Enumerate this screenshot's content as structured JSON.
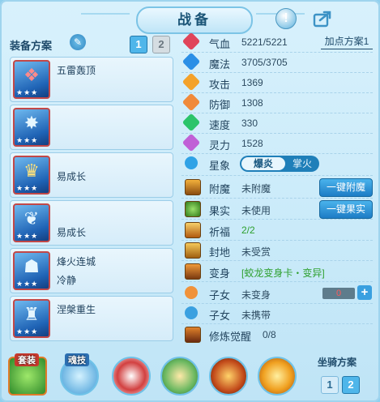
{
  "title": "战备",
  "header": {
    "help_icon": "exclamation-icon",
    "share_icon": "share-icon"
  },
  "equip_plan": {
    "label": "装备方案",
    "tabs": [
      "1",
      "2"
    ],
    "active_tab": "1"
  },
  "equip_cards": [
    {
      "name": "五雷轰顶",
      "sub": "",
      "stars": "★★★",
      "icon": "popsicle-icon"
    },
    {
      "name": "",
      "sub": "",
      "stars": "★★★",
      "icon": "crab-icon"
    },
    {
      "name": "易成长",
      "sub": "",
      "stars": "★★★",
      "icon": "beast-icon"
    },
    {
      "name": "易成长",
      "sub": "",
      "stars": "★★★",
      "icon": "dragon-icon"
    },
    {
      "name": "烽火连城",
      "sub": "冷静",
      "stars": "★★★",
      "icon": "mask-icon"
    },
    {
      "name": "涅槃重生",
      "sub": "",
      "stars": "★★★",
      "icon": "statue-icon"
    }
  ],
  "stats": [
    {
      "label": "气血",
      "value": "5221/5221",
      "color": "#e0445a"
    },
    {
      "label": "魔法",
      "value": "3705/3705",
      "color": "#2b8fe6"
    },
    {
      "label": "攻击",
      "value": "1369",
      "color": "#f4a22a"
    },
    {
      "label": "防御",
      "value": "1308",
      "color": "#f08a3a"
    },
    {
      "label": "速度",
      "value": "330",
      "color": "#2bc46a"
    },
    {
      "label": "灵力",
      "value": "1528",
      "color": "#c060d6"
    }
  ],
  "add_point_plan": "加点方案1",
  "constellation": {
    "label": "星象",
    "option_a": "爆炎",
    "option_b": "掌火"
  },
  "extras": [
    {
      "label": "附魔",
      "value": "未附魔",
      "value_color": "#2c4a60"
    },
    {
      "label": "果实",
      "value": "未使用",
      "value_color": "#2c4a60"
    },
    {
      "label": "祈福",
      "value": "2/2",
      "value_color": "#2ea02e"
    },
    {
      "label": "封地",
      "value": "未受赏",
      "value_color": "#2c4a60"
    },
    {
      "label": "变身",
      "value": "[蛟龙变身卡・变异]",
      "value_color": "#2ea02e"
    },
    {
      "label": "子女",
      "value": "未变身",
      "value_color": "#2c4a60"
    },
    {
      "label": "子女",
      "value": "未携带",
      "value_color": "#2c4a60"
    },
    {
      "label": "修炼觉醒",
      "value": "0/8",
      "value_color": "#2c4a60"
    }
  ],
  "buttons": {
    "enchant": "一键附魔",
    "fruit": "一键果实"
  },
  "child_counter": {
    "value": "0",
    "plus": "+"
  },
  "bottom": {
    "skill_tags": [
      "套装",
      "魂技"
    ],
    "mount_plan": {
      "label": "坐骑方案",
      "tabs": [
        "1",
        "2"
      ],
      "active_tab": "2"
    }
  }
}
